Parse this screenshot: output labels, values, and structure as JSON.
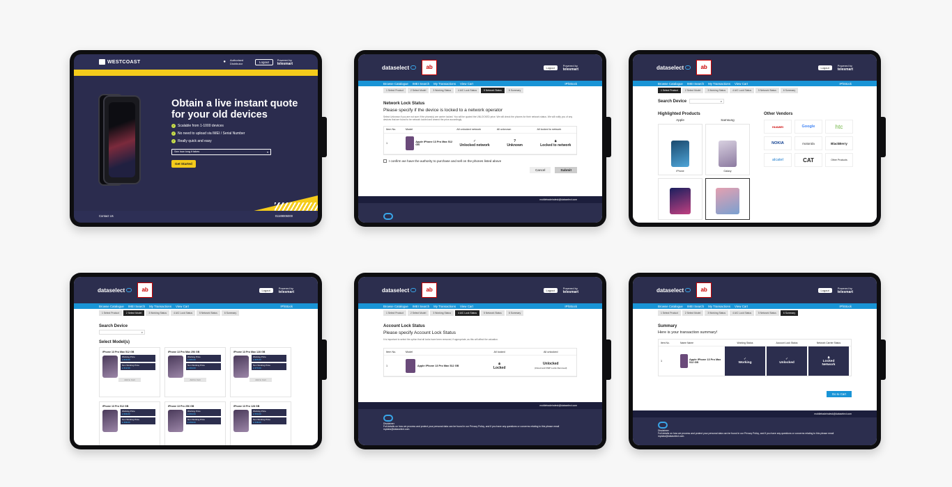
{
  "westcoast": {
    "brand": "WESTCOAST",
    "samsung_label": "Authorised Distributor",
    "logout": "Logout",
    "powered_by": "Powered by",
    "partner": "telesmart",
    "headline": "Obtain a live instant quote for your old devices",
    "bullets": [
      "Scalable from 1-1000 devices",
      "No need to upload via IMEI / Serial Number",
      "Really quick and easy"
    ],
    "select_placeholder": "See how long it takes",
    "cta": "Get Started",
    "contact": "Contact Us",
    "phone": "01189006000"
  },
  "dataselect": {
    "brand": "dataselect",
    "ab_logo": "ab",
    "logout": "Logout",
    "powered_by": "Powered by",
    "partner": "telesmart",
    "nav": [
      "Browse Catalogue",
      "IMEI Search",
      "My Transactions",
      "View Cart"
    ],
    "user": "IPhStock",
    "steps": [
      "1 Select Product",
      "2 Select Model",
      "3 Working Status",
      "4 A/C Lock Status",
      "5 Network Status",
      "6 Summary"
    ],
    "footer_email": "mobiletradeindesk@dataselect.com"
  },
  "network": {
    "title": "Network Lock Status",
    "question": "Please specify if the device is locked to a network operator",
    "help": "Select Unknown if you are not sure if the phone(s) are carrier locked. You will be quoted the UNLOCKED price. We will check the phones for their network status. We will notify you of any devices that are found to be network locked and amend the price accordingly.",
    "cols": [
      "Item No.",
      "Model",
      "All unlocked network",
      "All unknown",
      "All locked to network"
    ],
    "item_no": "1",
    "model": "Apple iPhone 13 Pro Max 512 GB",
    "opts": [
      "Unlocked network",
      "Unknown",
      "Locked to network"
    ],
    "confirm": "I confirm we have the authority to purchase and sell on the phones listed above",
    "cancel": "Cancel",
    "submit": "Submit"
  },
  "catalogue": {
    "search": "Search Device",
    "highlighted": "Highlighted Products",
    "other": "Other Vendors",
    "brands": [
      "Apple",
      "Samsung"
    ],
    "products": [
      "iPhone",
      "Galaxy"
    ],
    "vendors": [
      "HUAWEI",
      "Google",
      "htc",
      "NOKIA",
      "motorola",
      "BlackBerry",
      "alcatel",
      "CAT",
      "Other Products"
    ]
  },
  "models": {
    "search": "Search Device",
    "heading": "Select Model(s)",
    "items": [
      {
        "name": "iPhone 13 Pro Max 512 GB",
        "working": "£ 840.00",
        "non": "£ 312.00"
      },
      {
        "name": "iPhone 13 Pro Max 256 GB",
        "working": "£ 695.00",
        "non": "£ 303.00"
      },
      {
        "name": "iPhone 13 Pro Max 128 GB",
        "working": "£ 625.00",
        "non": "£ 270.00"
      },
      {
        "name": "iPhone 13 Pro 512 GB",
        "working": "£ 668.00",
        "non": "£ 268.00"
      },
      {
        "name": "iPhone 13 Pro 256 GB",
        "working": "£ 603.00",
        "non": "£ 258.00"
      },
      {
        "name": "iPhone 13 Pro 128 GB",
        "working": "£ 553.00",
        "non": "£ 248.00"
      }
    ],
    "working_label": "Working Price",
    "non_label": "Non Working Price",
    "qty": "Quantity",
    "add": "Add to Cart"
  },
  "account": {
    "title": "Account Lock Status",
    "question": "Please specify Account Lock Status",
    "help": "It is important to select the option that all locks have been removed, if appropriate, as this will affect the valuation.",
    "cols": [
      "Item No.",
      "Model",
      "All locked",
      "All unlocked"
    ],
    "item_no": "1",
    "model": "Apple iPhone 13 Pro Max 512 GB",
    "opts": [
      "Locked",
      "Unlocked"
    ],
    "unlocked_note": "(iCloud and FMiP Locks Removed)",
    "disclaimer": "Disclaimer",
    "policy": "Full details on how we process and protect your personal data can be found in our Privacy Policy, and if you have any questions or concerns relating to this please email mydata@dataselect.com."
  },
  "summary": {
    "title": "Summary",
    "subtitle": "Here is your transaction summary!",
    "cols": [
      "Item No.",
      "Name Name",
      "Working Status",
      "Account Lock Status",
      "Network Carrier Status"
    ],
    "item_no": "1",
    "model": "Apple iPhone 13 Pro Max 512 GB",
    "statuses": [
      "Working",
      "Unlocked",
      "Locked Network"
    ],
    "goto": "Go to Cart",
    "disclaimer": "Disclaimer",
    "policy": "Full details on how we process and protect your personal data can be found in our Privacy Policy, and if you have any questions or concerns relating to this please email mydata@dataselect.com."
  }
}
